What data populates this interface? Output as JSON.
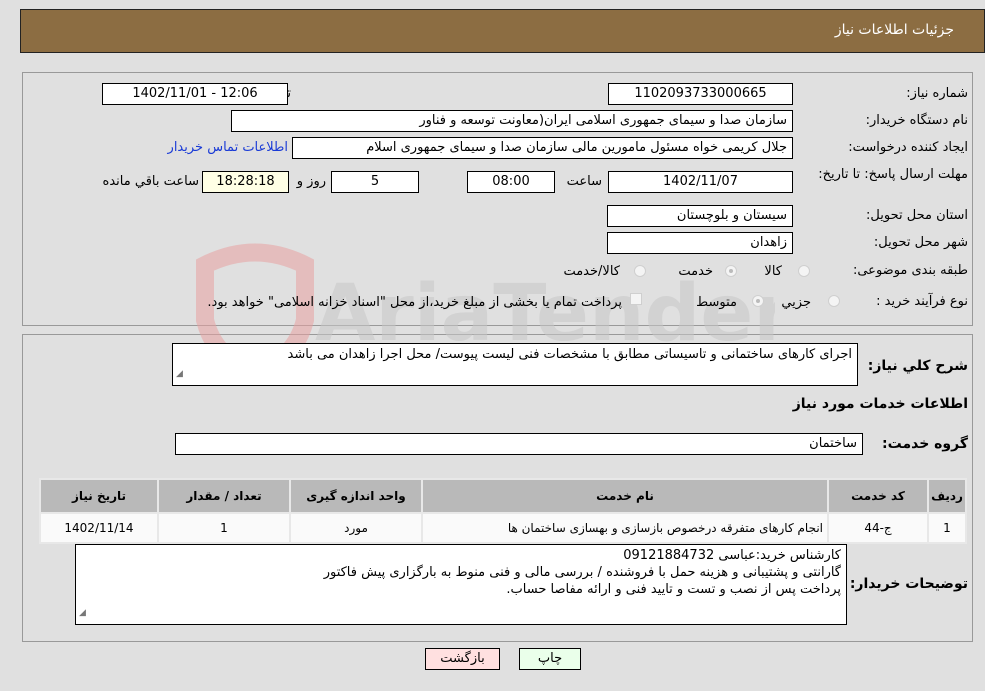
{
  "header": {
    "title": "جزئیات اطلاعات نیاز"
  },
  "form": {
    "need_number": {
      "label": "شماره نیاز:",
      "value": "1102093733000665"
    },
    "announce_datetime": {
      "label": "تاریخ و ساعت اعلان عمومي:",
      "value": "1402/11/01 - 12:06"
    },
    "buyer_org": {
      "label": "نام دستگاه خریدار:",
      "value": "سازمان صدا و سیمای جمهوری اسلامی ایران(معاونت توسعه و فناور"
    },
    "requester": {
      "label": "ایجاد کننده درخواست:",
      "value": "جلال کریمی خواه مسئول مامورین مالی  سازمان صدا و سیمای جمهوری اسلام"
    },
    "buyer_contact_link": "اطلاعات تماس خریدار",
    "deadline": {
      "label": "مهلت ارسال پاسخ: تا تاریخ:",
      "date": "1402/11/07",
      "time_label": "ساعت",
      "time": "08:00",
      "days": "5",
      "days_label": "روز و",
      "remaining": "18:28:18",
      "remaining_label": "ساعت باقي مانده"
    },
    "province": {
      "label": "استان محل تحویل:",
      "value": "سیستان و بلوچستان"
    },
    "city": {
      "label": "شهر محل تحویل:",
      "value": "زاهدان"
    },
    "category": {
      "label": "طبقه بندی موضوعی:",
      "options": [
        "کالا",
        "خدمت",
        "کالا/خدمت"
      ],
      "selected": "خدمت"
    },
    "purchase_type": {
      "label": "نوع فرآیند خرید :",
      "options": [
        "جزيي",
        "متوسط"
      ],
      "selected": "متوسط",
      "treasury_note": "پرداخت تمام یا بخشی از مبلغ خرید،از محل \"اسناد خزانه اسلامی\" خواهد بود."
    }
  },
  "description": {
    "label": "شرح کلي نیاز:",
    "value": "اجرای کارهای ساختمانی و تاسیساتی مطابق با مشخصات فنی لیست پیوست/ محل اجرا زاهدان می باشد"
  },
  "services": {
    "section_title": "اطلاعات خدمات مورد نیاز",
    "group_label": "گروه خدمت:",
    "group_value": "ساختمان",
    "columns": [
      "ردیف",
      "کد خدمت",
      "نام خدمت",
      "واحد اندازه گیری",
      "تعداد / مقدار",
      "تاریخ نیاز"
    ],
    "rows": [
      [
        "1",
        "ج-44",
        "انجام کارهای متفرقه درخصوص بازسازی و بهسازی ساختمان ها",
        "مورد",
        "1",
        "1402/11/14"
      ]
    ]
  },
  "buyer_notes": {
    "label": "توضیحات خریدار:",
    "lines": [
      "کارشناس خرید:عباسی 09121884732",
      "گارانتی و پشتیبانی و هزینه حمل با فروشنده / بررسی مالی و فنی منوط به بارگزاری پیش فاکتور",
      "پرداخت پس از نصب و تست و تایید فنی  و ارائه مفاصا حساب."
    ]
  },
  "buttons": {
    "print": "چاپ",
    "back": "بازگشت"
  },
  "watermark": {
    "text": "AriaTender.net"
  },
  "colors": {
    "header_bg": "#8c6d42",
    "link": "#1a3bd6",
    "print_bg": "#eaffea",
    "back_bg": "#ffe0e0",
    "remaining_bg": "#ffffe5"
  }
}
